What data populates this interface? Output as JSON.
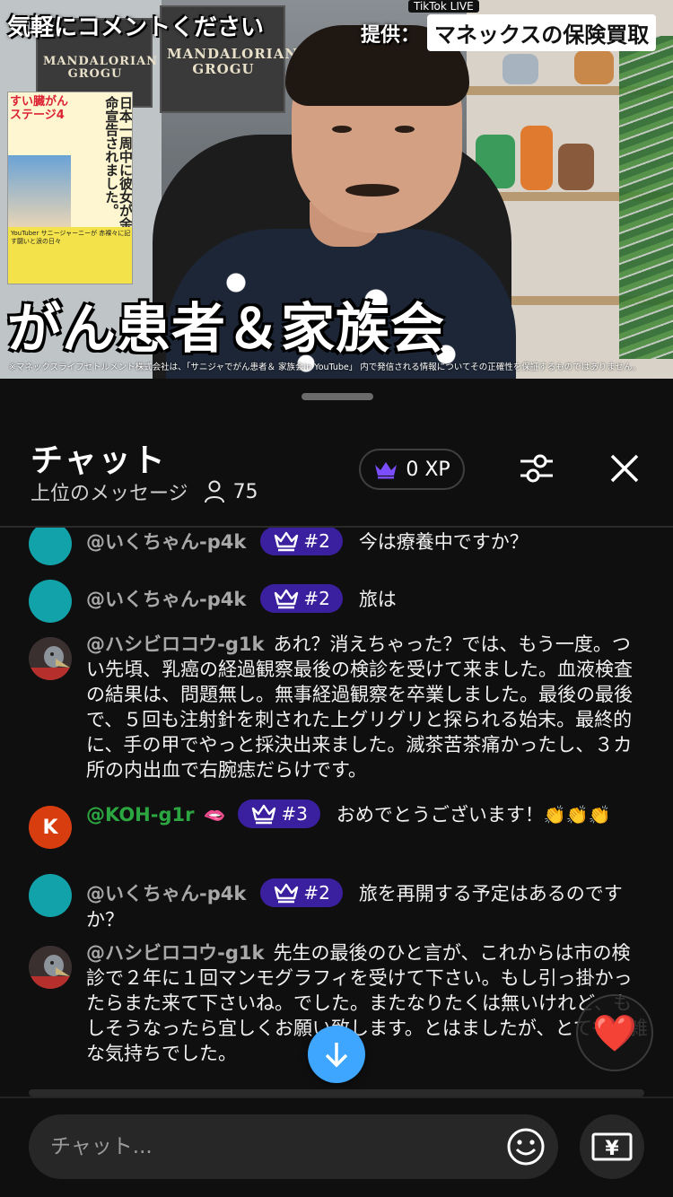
{
  "video": {
    "overlay_top_left": "気軽にコメントください",
    "sponsor_label": "提供：",
    "sponsor_name": "マネックスの保険買取",
    "platform_tag": "TikTok LIVE",
    "big_caption": "がん患者＆家族会",
    "disclaimer": "※マネックスライフセトルメント株式会社は、「サニジャでがん患者＆ 家族会in YouTube」 内で発信される情報についてその正確性を保証するものではありません。",
    "poster_left": "MANDALORIAN GROGU",
    "poster_right": "MANDALORIAN GROGU",
    "book": {
      "title": "日本一周中に彼女が余命宣告されました。",
      "subtitle": "すい臓がん ステージ4",
      "band": "YouTuber サニージャーニーが 赤裸々に記す闘いと涙の日々"
    }
  },
  "chat": {
    "title": "チャット",
    "subtitle": "上位のメッセージ",
    "viewer_count": "75",
    "xp": "0 XP",
    "messages": [
      {
        "user": "@いくちゃん-p4k",
        "rank": "#2",
        "text": "今は療養中ですか？",
        "avatar": "teal"
      },
      {
        "user": "@いくちゃん-p4k",
        "rank": "#2",
        "text": "旅は",
        "avatar": "teal"
      },
      {
        "user": "@ハシビロコウ-g1k",
        "rank": "",
        "text": "あれ？消えちゃった？では、もう一度。つい先頃、乳癌の経過観察最後の検診を受けて来ました。血液検査の結果は、問題無し。無事経過観察を卒業しました。最後の最後で、５回も注射針を刺された上グリグリと探られる始末。最終的に、手の甲でやっと採決出来ました。滅茶苦茶痛かったし、３カ所の内出血で右腕痣だらけです。",
        "avatar": "bird"
      },
      {
        "user": "@KOH-g1r",
        "rank": "#3",
        "text": "おめでとうございます！",
        "emoji": "👏👏👏",
        "avatar": "K",
        "badge_emoji": "🫦"
      },
      {
        "user": "@いくちゃん-p4k",
        "rank": "#2",
        "text": "旅を再開する予定はあるのですか？",
        "avatar": "teal"
      },
      {
        "user": "@ハシビロコウ-g1k",
        "rank": "",
        "text": "先生の最後のひと言が、これからは市の検診で２年に１回マンモグラフィを受けて下さい。もし引っ掛かったらまた来て下さいね。でした。またなりたくは無いけれど、もしそうなったら宜しくお願い致します。とはましたが、とても複雑な気持ちでした。",
        "avatar": "bird"
      }
    ],
    "input_placeholder": "チャット...",
    "heart": "❤️",
    "currency_symbol": "¥"
  }
}
